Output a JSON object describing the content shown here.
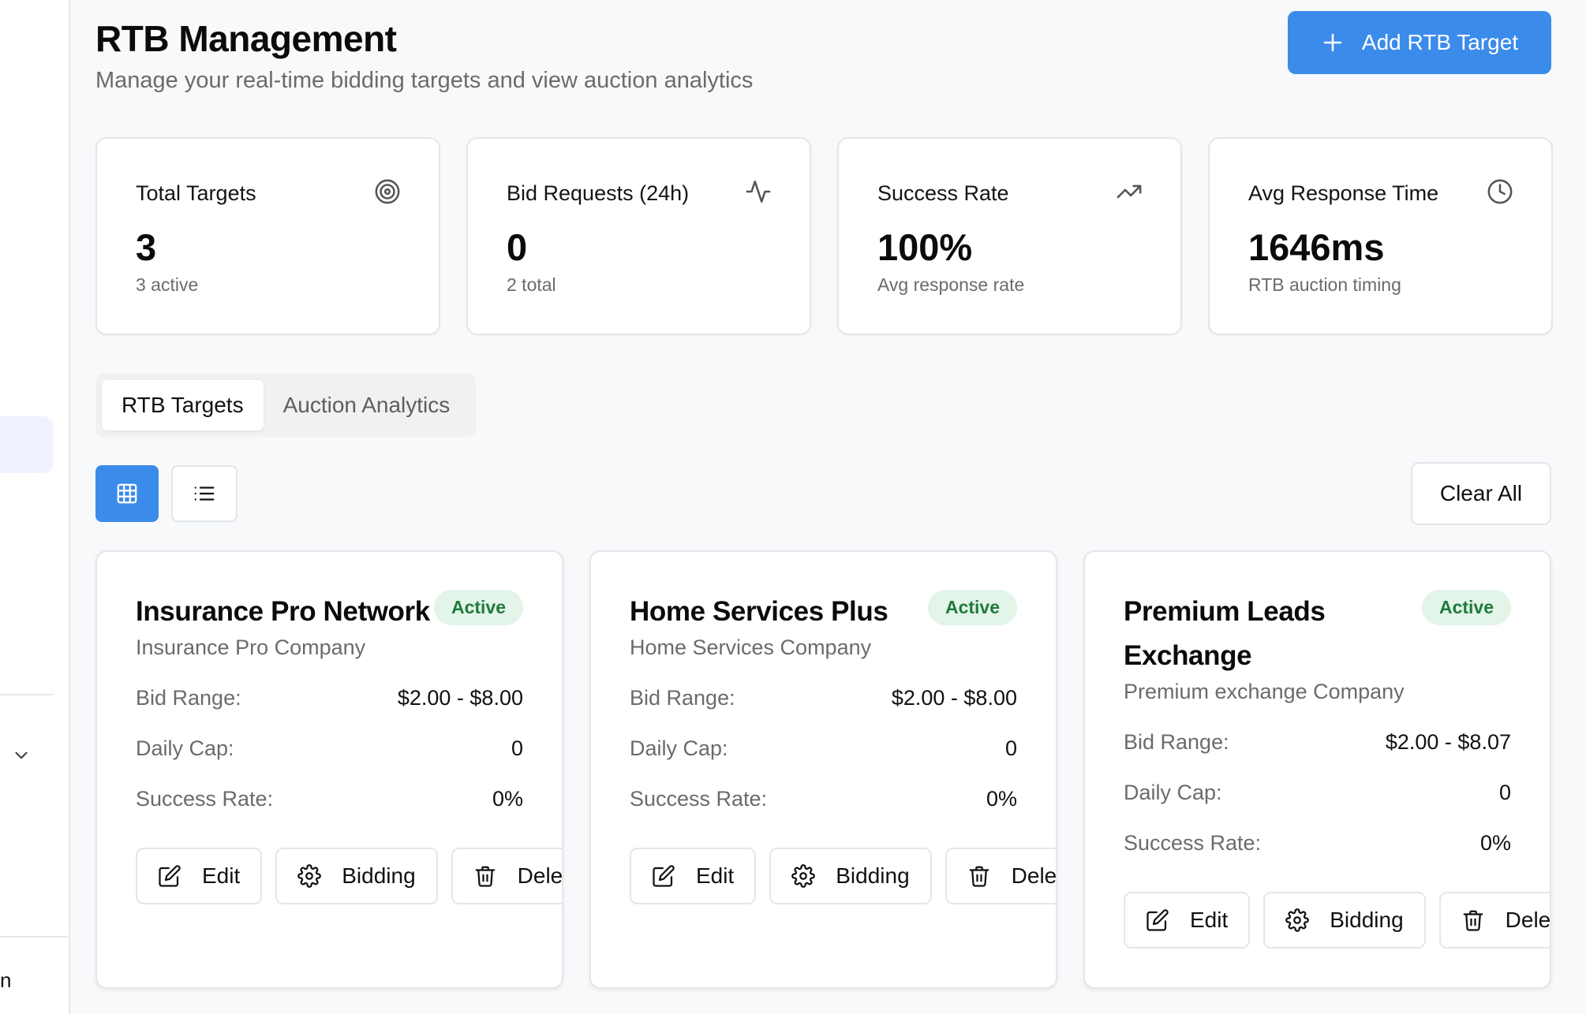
{
  "header": {
    "title": "RTB Management",
    "subtitle": "Manage your real-time bidding targets and view auction analytics",
    "add_button_label": "Add RTB Target"
  },
  "sidebar": {
    "truncated_label": "n"
  },
  "stats": [
    {
      "label": "Total Targets",
      "value": "3",
      "sub": "3 active",
      "icon": "target-icon"
    },
    {
      "label": "Bid Requests (24h)",
      "value": "0",
      "sub": "2 total",
      "icon": "activity-icon"
    },
    {
      "label": "Success Rate",
      "value": "100%",
      "sub": "Avg response rate",
      "icon": "trending-up-icon"
    },
    {
      "label": "Avg Response Time",
      "value": "1646ms",
      "sub": "RTB auction timing",
      "icon": "clock-icon"
    }
  ],
  "tabs": [
    {
      "label": "RTB Targets",
      "active": true
    },
    {
      "label": "Auction Analytics",
      "active": false
    }
  ],
  "toolbar": {
    "clear_all_label": "Clear All"
  },
  "targets": [
    {
      "name": "Insurance Pro Network",
      "company": "Insurance Pro Company",
      "status": "Active",
      "bid_range_label": "Bid Range:",
      "bid_range": "$2.00 - $8.00",
      "daily_cap_label": "Daily Cap:",
      "daily_cap": "0",
      "success_rate_label": "Success Rate:",
      "success_rate": "0%",
      "edit_label": "Edit",
      "bidding_label": "Bidding",
      "delete_label": "Delete"
    },
    {
      "name": "Home Services Plus",
      "company": "Home Services Company",
      "status": "Active",
      "bid_range_label": "Bid Range:",
      "bid_range": "$2.00 - $8.00",
      "daily_cap_label": "Daily Cap:",
      "daily_cap": "0",
      "success_rate_label": "Success Rate:",
      "success_rate": "0%",
      "edit_label": "Edit",
      "bidding_label": "Bidding",
      "delete_label": "Delete"
    },
    {
      "name": "Premium Leads Exchange",
      "company": "Premium exchange Company",
      "status": "Active",
      "bid_range_label": "Bid Range:",
      "bid_range": "$2.00 - $8.07",
      "daily_cap_label": "Daily Cap:",
      "daily_cap": "0",
      "success_rate_label": "Success Rate:",
      "success_rate": "0%",
      "edit_label": "Edit",
      "bidding_label": "Bidding",
      "delete_label": "Delete"
    }
  ],
  "colors": {
    "accent": "#3b8bea",
    "badge_bg": "#e3f4e8",
    "badge_text": "#1f7a3c"
  }
}
